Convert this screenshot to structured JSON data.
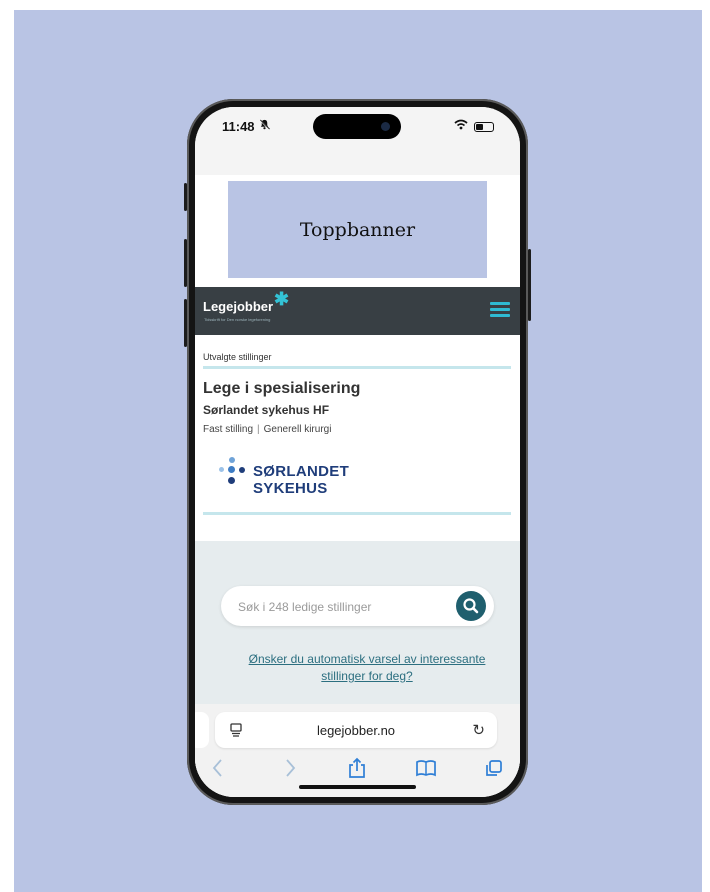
{
  "status_bar": {
    "time": "11:48",
    "bell_icon": "bell-slash-icon",
    "wifi_icon": "wifi-icon",
    "battery_icon": "battery-icon"
  },
  "banner": {
    "text": "Toppbanner"
  },
  "site": {
    "logo_text": "Legejobber",
    "logo_tagline": "Tidsskrift for Den norske legeforening",
    "menu_icon": "hamburger-menu-icon"
  },
  "featured": {
    "section_label": "Utvalgte stillinger",
    "job_title": "Lege i spesialisering",
    "employer": "Sørlandet sykehus HF",
    "employment_type": "Fast stilling",
    "specialty": "Generell kirurgi",
    "employer_logo_text": "SØRLANDET SYKEHUS"
  },
  "search": {
    "placeholder": "Søk i 248 ledige stillinger",
    "button_icon": "search-icon"
  },
  "alert_link": "Ønsker du automatisk varsel av interessante stillinger for deg?",
  "browser": {
    "url": "legejobber.no",
    "toolbar": [
      "back-icon",
      "forward-icon",
      "share-icon",
      "bookmarks-icon",
      "tabs-icon"
    ]
  },
  "colors": {
    "background": "#b9c4e4",
    "navbar": "#383f44",
    "accent": "#2fbad2",
    "link": "#2c6f80",
    "search_button": "#1f5f6e"
  }
}
